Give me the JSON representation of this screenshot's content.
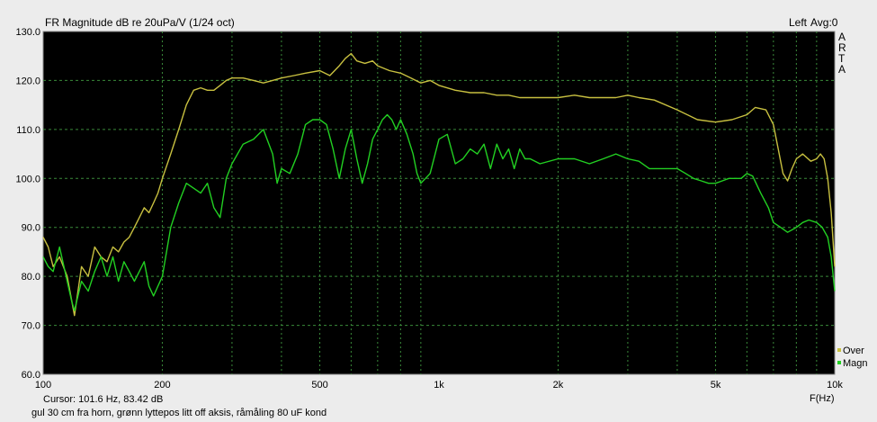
{
  "window": {
    "title": "FR Magnitude dB re 20uPa/V (1/24 oct)",
    "channel": "Left",
    "avg": "Avg:0",
    "brand": [
      "A",
      "R",
      "T",
      "A"
    ]
  },
  "cursor_text": "Cursor:   101.6 Hz, 83.42 dB",
  "note_text": "gul 30 cm fra horn, grønn lyttepos litt off aksis, råmåling 80 uF kond",
  "colors": {
    "background": "#ececec",
    "plot_bg": "#000000",
    "grid": "#3a8a3a",
    "over": "#c8c040",
    "magn": "#22d022"
  },
  "chart_data": {
    "type": "line",
    "title": "FR Magnitude dB re 20uPa/V (1/24 oct)",
    "xlabel": "F(Hz)",
    "ylabel": "",
    "xscale": "log",
    "xlim": [
      100,
      10000
    ],
    "ylim": [
      60,
      130
    ],
    "x_ticks": [
      100,
      200,
      500,
      1000,
      2000,
      5000,
      10000
    ],
    "x_tick_labels": [
      "100",
      "200",
      "500",
      "1k",
      "2k",
      "5k",
      "10k"
    ],
    "y_ticks": [
      60,
      70,
      80,
      90,
      100,
      110,
      120,
      130
    ],
    "y_tick_labels": [
      "60.0",
      "70.0",
      "80.0",
      "90.0",
      "100.0",
      "110.0",
      "120.0",
      "130.0"
    ],
    "grid": true,
    "legend_position": "bottom-right",
    "series": [
      {
        "name": "Over",
        "color": "#c8c040",
        "points": [
          [
            100,
            88
          ],
          [
            103,
            86
          ],
          [
            106,
            82
          ],
          [
            110,
            84
          ],
          [
            115,
            80
          ],
          [
            120,
            72
          ],
          [
            125,
            82
          ],
          [
            130,
            80
          ],
          [
            135,
            86
          ],
          [
            140,
            84
          ],
          [
            145,
            83
          ],
          [
            150,
            86
          ],
          [
            155,
            85
          ],
          [
            160,
            87
          ],
          [
            165,
            88
          ],
          [
            170,
            90
          ],
          [
            175,
            92
          ],
          [
            180,
            94
          ],
          [
            185,
            93
          ],
          [
            190,
            95
          ],
          [
            195,
            97
          ],
          [
            200,
            100
          ],
          [
            210,
            105
          ],
          [
            220,
            110
          ],
          [
            230,
            115
          ],
          [
            240,
            118
          ],
          [
            250,
            118.5
          ],
          [
            260,
            118
          ],
          [
            270,
            118
          ],
          [
            280,
            119
          ],
          [
            290,
            120
          ],
          [
            300,
            120.5
          ],
          [
            320,
            120.5
          ],
          [
            340,
            120
          ],
          [
            360,
            119.5
          ],
          [
            380,
            120
          ],
          [
            400,
            120.5
          ],
          [
            430,
            121
          ],
          [
            460,
            121.5
          ],
          [
            500,
            122
          ],
          [
            530,
            121
          ],
          [
            560,
            123
          ],
          [
            580,
            124.5
          ],
          [
            600,
            125.5
          ],
          [
            620,
            124
          ],
          [
            650,
            123.5
          ],
          [
            680,
            124
          ],
          [
            700,
            123
          ],
          [
            750,
            122
          ],
          [
            800,
            121.5
          ],
          [
            850,
            120.5
          ],
          [
            900,
            119.5
          ],
          [
            950,
            120
          ],
          [
            1000,
            119
          ],
          [
            1100,
            118
          ],
          [
            1200,
            117.5
          ],
          [
            1300,
            117.5
          ],
          [
            1400,
            117
          ],
          [
            1500,
            117
          ],
          [
            1600,
            116.5
          ],
          [
            1800,
            116.5
          ],
          [
            2000,
            116.5
          ],
          [
            2200,
            117
          ],
          [
            2400,
            116.5
          ],
          [
            2600,
            116.5
          ],
          [
            2800,
            116.5
          ],
          [
            3000,
            117
          ],
          [
            3200,
            116.5
          ],
          [
            3500,
            116
          ],
          [
            4000,
            114
          ],
          [
            4500,
            112
          ],
          [
            5000,
            111.5
          ],
          [
            5500,
            112
          ],
          [
            6000,
            113
          ],
          [
            6300,
            114.5
          ],
          [
            6700,
            114
          ],
          [
            7000,
            111
          ],
          [
            7200,
            106
          ],
          [
            7400,
            101
          ],
          [
            7600,
            99.5
          ],
          [
            7800,
            102
          ],
          [
            8000,
            104
          ],
          [
            8300,
            105
          ],
          [
            8700,
            103.5
          ],
          [
            9000,
            104
          ],
          [
            9200,
            105
          ],
          [
            9400,
            104
          ],
          [
            9600,
            100
          ],
          [
            9800,
            93
          ],
          [
            10000,
            82
          ]
        ]
      },
      {
        "name": "Magn",
        "color": "#22d022",
        "points": [
          [
            100,
            84
          ],
          [
            103,
            82
          ],
          [
            106,
            81
          ],
          [
            110,
            86
          ],
          [
            115,
            79
          ],
          [
            118,
            75
          ],
          [
            120,
            73
          ],
          [
            125,
            79
          ],
          [
            130,
            77
          ],
          [
            135,
            81
          ],
          [
            140,
            84
          ],
          [
            145,
            80
          ],
          [
            150,
            84
          ],
          [
            155,
            79
          ],
          [
            160,
            83
          ],
          [
            165,
            81
          ],
          [
            170,
            79
          ],
          [
            175,
            81
          ],
          [
            180,
            83
          ],
          [
            185,
            78
          ],
          [
            190,
            76
          ],
          [
            200,
            80
          ],
          [
            210,
            90
          ],
          [
            220,
            95
          ],
          [
            230,
            99
          ],
          [
            240,
            98
          ],
          [
            250,
            97
          ],
          [
            260,
            99
          ],
          [
            270,
            94
          ],
          [
            280,
            92
          ],
          [
            290,
            100
          ],
          [
            300,
            103
          ],
          [
            320,
            107
          ],
          [
            340,
            108
          ],
          [
            360,
            110
          ],
          [
            380,
            105
          ],
          [
            390,
            99
          ],
          [
            400,
            102
          ],
          [
            420,
            101
          ],
          [
            440,
            105
          ],
          [
            460,
            111
          ],
          [
            480,
            112
          ],
          [
            500,
            112
          ],
          [
            520,
            111
          ],
          [
            540,
            106
          ],
          [
            560,
            100
          ],
          [
            580,
            106
          ],
          [
            600,
            110
          ],
          [
            620,
            104
          ],
          [
            640,
            99
          ],
          [
            660,
            103
          ],
          [
            680,
            108
          ],
          [
            700,
            110
          ],
          [
            720,
            112
          ],
          [
            740,
            113
          ],
          [
            760,
            112
          ],
          [
            780,
            110
          ],
          [
            800,
            112
          ],
          [
            830,
            109
          ],
          [
            860,
            105
          ],
          [
            880,
            101
          ],
          [
            900,
            99
          ],
          [
            950,
            101
          ],
          [
            1000,
            108
          ],
          [
            1050,
            109
          ],
          [
            1100,
            103
          ],
          [
            1150,
            104
          ],
          [
            1200,
            106
          ],
          [
            1250,
            105
          ],
          [
            1300,
            107
          ],
          [
            1350,
            102
          ],
          [
            1400,
            107
          ],
          [
            1450,
            104
          ],
          [
            1500,
            106
          ],
          [
            1550,
            102
          ],
          [
            1600,
            106
          ],
          [
            1650,
            104
          ],
          [
            1700,
            104
          ],
          [
            1800,
            103
          ],
          [
            2000,
            104
          ],
          [
            2200,
            104
          ],
          [
            2400,
            103
          ],
          [
            2600,
            104
          ],
          [
            2800,
            105
          ],
          [
            3000,
            104
          ],
          [
            3200,
            103.5
          ],
          [
            3400,
            102
          ],
          [
            3600,
            102
          ],
          [
            3800,
            102
          ],
          [
            4000,
            102
          ],
          [
            4200,
            101
          ],
          [
            4400,
            100
          ],
          [
            4600,
            99.5
          ],
          [
            4800,
            99
          ],
          [
            5000,
            99
          ],
          [
            5200,
            99.5
          ],
          [
            5400,
            100
          ],
          [
            5600,
            100
          ],
          [
            5800,
            100
          ],
          [
            6000,
            101
          ],
          [
            6200,
            100.5
          ],
          [
            6500,
            97
          ],
          [
            6800,
            94
          ],
          [
            7000,
            91
          ],
          [
            7300,
            90
          ],
          [
            7600,
            89
          ],
          [
            8000,
            90
          ],
          [
            8300,
            91
          ],
          [
            8600,
            91.5
          ],
          [
            9000,
            91
          ],
          [
            9300,
            90
          ],
          [
            9600,
            88
          ],
          [
            9800,
            84
          ],
          [
            10000,
            77
          ]
        ]
      }
    ]
  }
}
